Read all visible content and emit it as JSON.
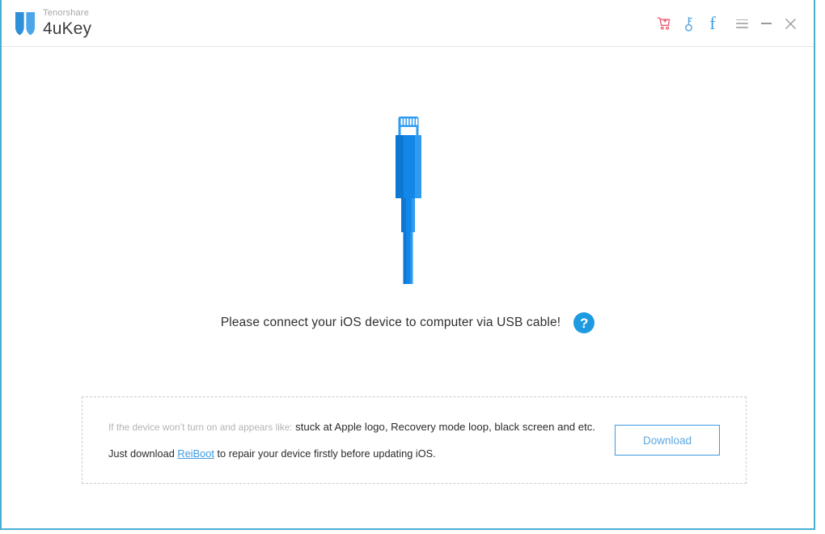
{
  "window": {
    "brand_sup": "Tenorshare",
    "brand_name": "4uKey",
    "border_color": "#4aaed2"
  },
  "titlebar": {
    "icons": [
      {
        "name": "cart-icon",
        "label": "Buy",
        "color": "#ef5b6e"
      },
      {
        "name": "key-icon",
        "label": "Register",
        "color": "#5ba9e2"
      },
      {
        "name": "facebook-icon",
        "label": "f",
        "color": "#3d9ae0"
      },
      {
        "name": "menu-icon",
        "label": "Menu",
        "color": "#b0b0b0"
      },
      {
        "name": "minimize-icon",
        "label": "Minimize",
        "color": "#9a9a9a"
      },
      {
        "name": "close-icon",
        "label": "Close",
        "color": "#9a9a9a"
      }
    ],
    "close_glyph": "✕"
  },
  "main": {
    "cable_alt": "lightning-usb-cable-illustration",
    "cable_color": "#1387e8",
    "cable_color_dark": "#0d77d4",
    "cable_color_light": "#2f9bf0",
    "connect_message": "Please connect your iOS device to computer via USB cable!",
    "help_glyph": "?",
    "help_color": "#1e9ae0"
  },
  "notice": {
    "line1_muted": "If the device won’t turn on and appears like:",
    "line1_strong": "stuck at Apple logo, Recovery mode loop, black screen and etc.",
    "line2_prefix": "Just download ",
    "line2_link": "ReiBoot",
    "line2_suffix": " to repair your device firstly before updating iOS.",
    "download_label": "Download",
    "accent_color": "#3d9ae0"
  }
}
